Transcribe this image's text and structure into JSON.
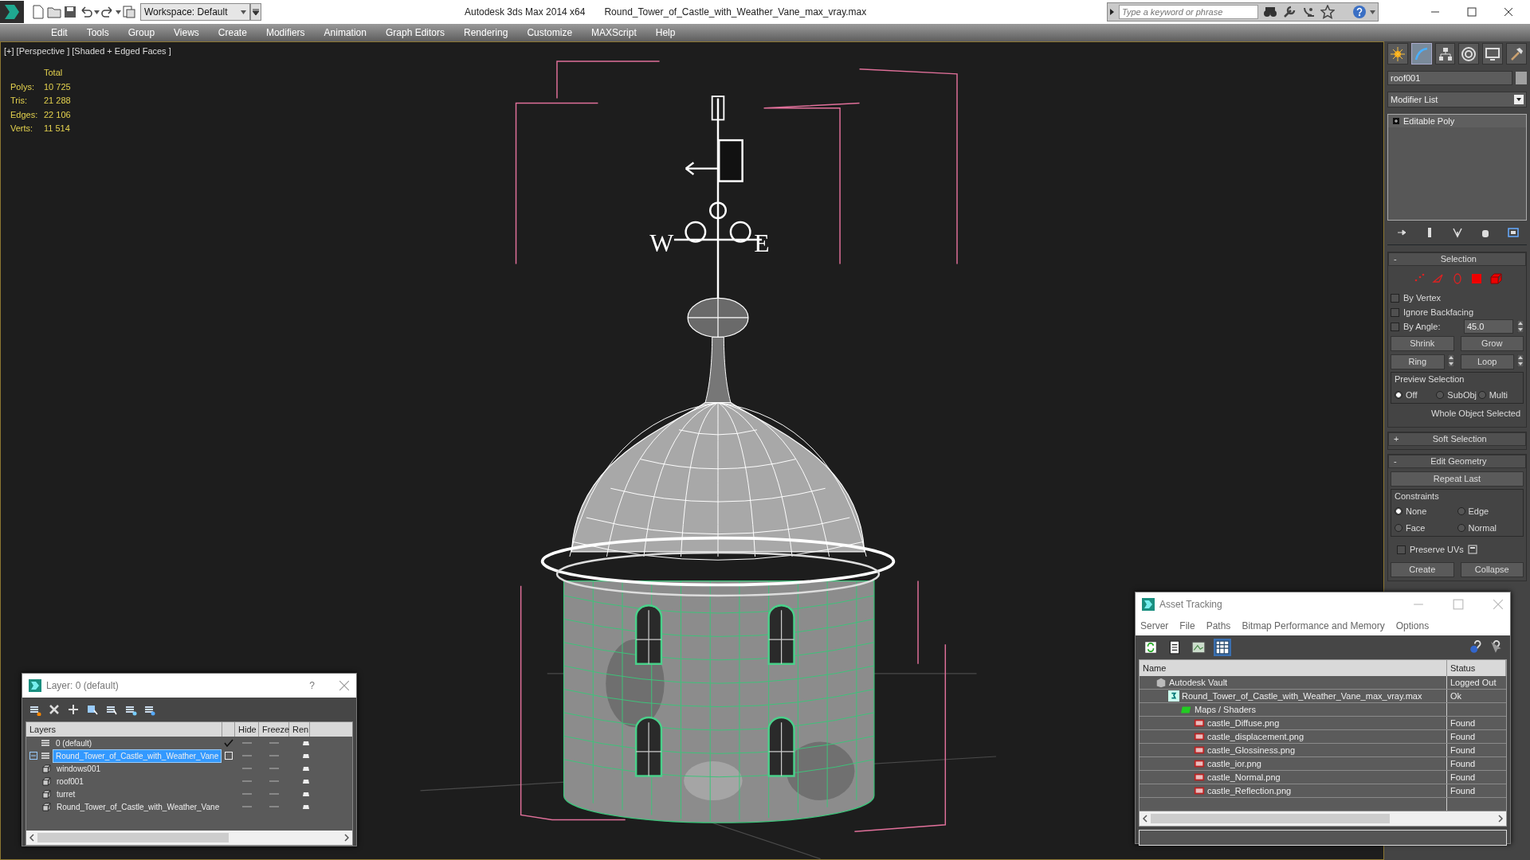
{
  "title_bar": {
    "workspace": "Workspace: Default",
    "app_title": "Autodesk 3ds Max  2014 x64",
    "file_title": "Round_Tower_of_Castle_with_Weather_Vane_max_vray.max",
    "search": {
      "placeholder": "Type a keyword or phrase"
    }
  },
  "menu": [
    "Edit",
    "Tools",
    "Group",
    "Views",
    "Create",
    "Modifiers",
    "Animation",
    "Graph Editors",
    "Rendering",
    "Customize",
    "MAXScript",
    "Help"
  ],
  "viewport": {
    "label": "[+] [Perspective ] [Shaded + Edged Faces ]",
    "stats": {
      "header": "Total",
      "rows": [
        {
          "label": "Polys:",
          "value": "10 725"
        },
        {
          "label": "Tris:",
          "value": "21 288"
        },
        {
          "label": "Edges:",
          "value": "22 106"
        },
        {
          "label": "Verts:",
          "value": "11 514"
        }
      ]
    },
    "vane_letters": [
      "W",
      "E"
    ]
  },
  "command_panel": {
    "tabs": [
      {
        "kind": "create",
        "selected": false
      },
      {
        "kind": "modify",
        "selected": true
      },
      {
        "kind": "hierarchy",
        "selected": false
      },
      {
        "kind": "motion",
        "selected": false
      },
      {
        "kind": "display",
        "selected": false
      },
      {
        "kind": "utilities",
        "selected": false
      }
    ],
    "object_name": "roof001",
    "modifier_list": "Modifier List",
    "stack": [
      {
        "label": "Editable Poly"
      }
    ],
    "rollouts": [
      {
        "kind": "selection",
        "sign": "-",
        "title": "Selection"
      },
      {
        "kind": "collapsed",
        "sign": "+",
        "title": "Soft Selection"
      },
      {
        "kind": "geometry",
        "sign": "-",
        "title": "Edit Geometry"
      }
    ],
    "selection": {
      "checkboxes": [
        {
          "label": "By Vertex",
          "checked": false
        },
        {
          "label": "Ignore Backfacing",
          "checked": false
        },
        {
          "label": "By Angle:",
          "checked": false,
          "value": "45.0"
        }
      ],
      "button_rows": [
        [
          {
            "label": "Shrink",
            "spinner": false
          },
          {
            "label": "Grow",
            "spinner": false
          }
        ],
        [
          {
            "label": "Ring",
            "spinner": true
          },
          {
            "label": "Loop",
            "spinner": true
          }
        ]
      ],
      "preview": {
        "title": "Preview Selection",
        "options": [
          {
            "label": "Off",
            "selected": true
          },
          {
            "label": "SubObj",
            "selected": false
          },
          {
            "label": "Multi",
            "selected": false
          }
        ]
      },
      "status": "Whole Object Selected"
    },
    "edit_geometry": {
      "repeat": "Repeat Last",
      "constraints": {
        "title": "Constraints",
        "options": [
          {
            "label": "None",
            "selected": true
          },
          {
            "label": "Edge",
            "selected": false
          },
          {
            "label": "Face",
            "selected": false
          },
          {
            "label": "Normal",
            "selected": false
          }
        ]
      },
      "preserve_uvs": {
        "label": "Preserve UVs",
        "checked": false
      },
      "buttons": [
        "Create",
        "Collapse"
      ]
    }
  },
  "layer_dialog": {
    "title": "Layer: 0 (default)",
    "help": "?",
    "columns": [
      "Layers",
      "Hide",
      "Freeze",
      "Ren"
    ],
    "layers": [
      {
        "kind": "layer",
        "name": "0 (default)",
        "selected": false,
        "current": true
      },
      {
        "kind": "layer",
        "name": "Round_Tower_of_Castle_with_Weather_Vane",
        "selected": true,
        "current": false,
        "expanded": true,
        "children": [
          {
            "kind": "object",
            "name": "windows001",
            "selected": false
          },
          {
            "kind": "object",
            "name": "roof001",
            "selected": false
          },
          {
            "kind": "object",
            "name": "turret",
            "selected": false
          },
          {
            "kind": "object",
            "name": "Round_Tower_of_Castle_with_Weather_Vane",
            "selected": false
          }
        ]
      }
    ]
  },
  "asset_tracking": {
    "title": "Asset Tracking",
    "menu": [
      "Server",
      "File",
      "Paths",
      "Bitmap Performance and Memory",
      "Options"
    ],
    "toolbar": [
      {
        "kind": "refresh",
        "selected": false
      },
      {
        "kind": "list",
        "selected": false
      },
      {
        "kind": "thumbnails",
        "selected": false
      },
      {
        "kind": "table",
        "selected": true
      }
    ],
    "columns": [
      "Name",
      "Status"
    ],
    "assets": [
      {
        "kind": "vault",
        "name": "Autodesk Vault",
        "status": "Logged Out",
        "children": [
          {
            "kind": "scene",
            "name": "Round_Tower_of_Castle_with_Weather_Vane_max_vray.max",
            "status": "Ok",
            "children": [
              {
                "kind": "folder",
                "name": "Maps / Shaders",
                "children": [
                  {
                    "kind": "png",
                    "name": "castle_Diffuse.png",
                    "status": "Found"
                  },
                  {
                    "kind": "png",
                    "name": "castle_displacement.png",
                    "status": "Found"
                  },
                  {
                    "kind": "png",
                    "name": "castle_Glossiness.png",
                    "status": "Found"
                  },
                  {
                    "kind": "png",
                    "name": "castle_ior.png",
                    "status": "Found"
                  },
                  {
                    "kind": "png",
                    "name": "castle_Normal.png",
                    "status": "Found"
                  },
                  {
                    "kind": "png",
                    "name": "castle_Reflection.png",
                    "status": "Found"
                  }
                ]
              }
            ]
          }
        ]
      }
    ]
  }
}
